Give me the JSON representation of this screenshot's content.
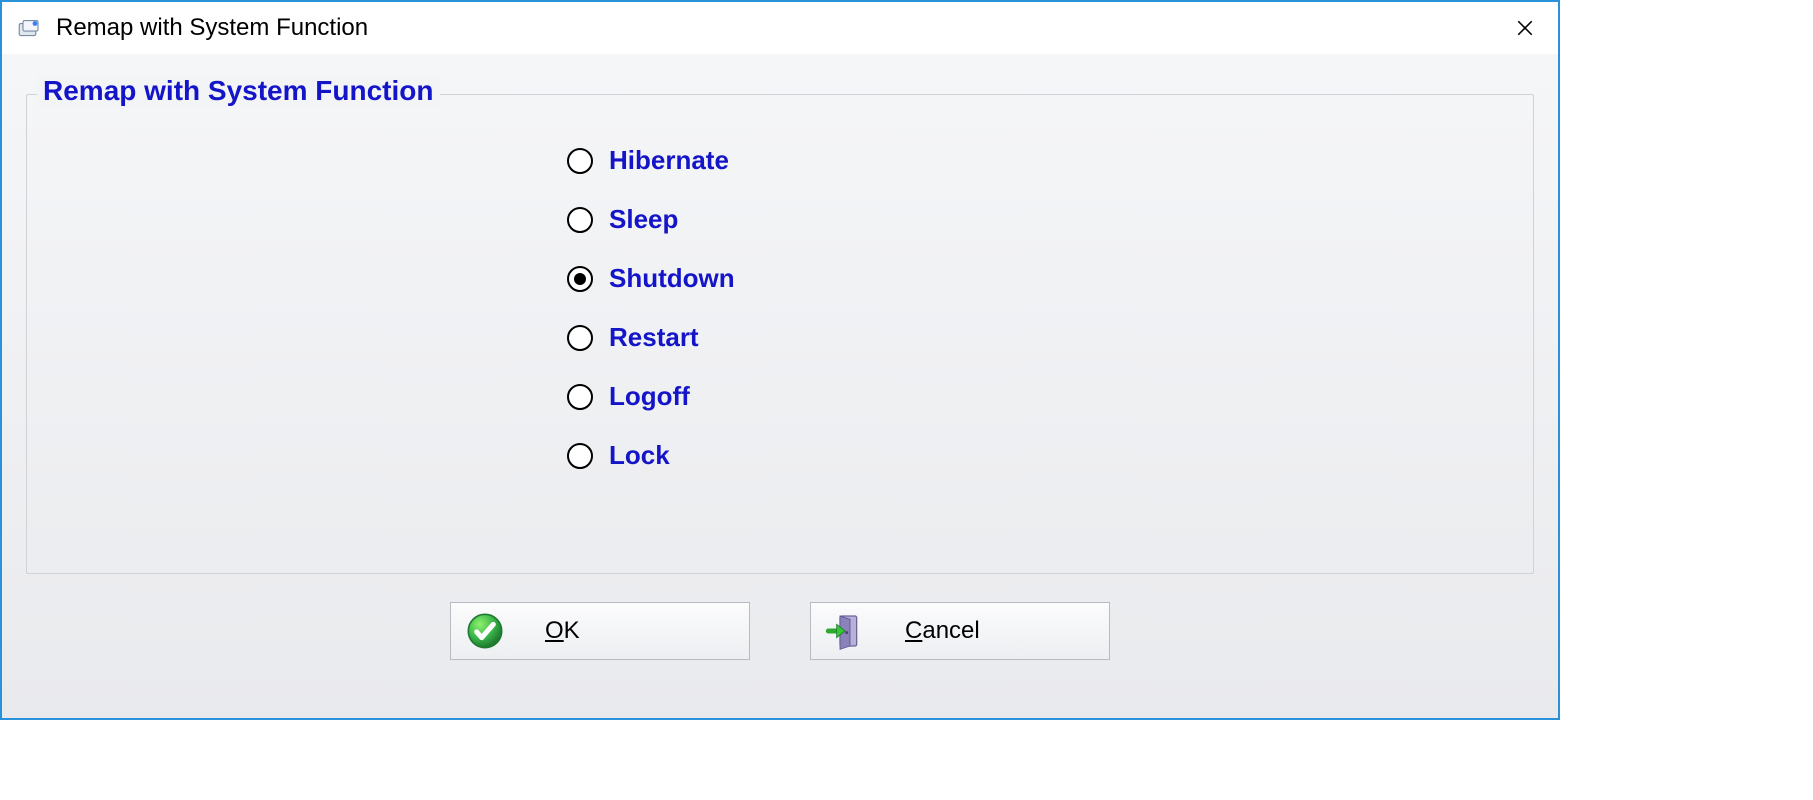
{
  "window": {
    "title": "Remap with System Function"
  },
  "group": {
    "legend": "Remap with System Function",
    "options": [
      {
        "id": "hibernate",
        "label": "Hibernate",
        "selected": false
      },
      {
        "id": "sleep",
        "label": "Sleep",
        "selected": false
      },
      {
        "id": "shutdown",
        "label": "Shutdown",
        "selected": true
      },
      {
        "id": "restart",
        "label": "Restart",
        "selected": false
      },
      {
        "id": "logoff",
        "label": "Logoff",
        "selected": false
      },
      {
        "id": "lock",
        "label": "Lock",
        "selected": false
      }
    ]
  },
  "buttons": {
    "ok": {
      "label": "OK",
      "accel_index": 0
    },
    "cancel": {
      "label": "Cancel",
      "accel_index": 0
    }
  }
}
